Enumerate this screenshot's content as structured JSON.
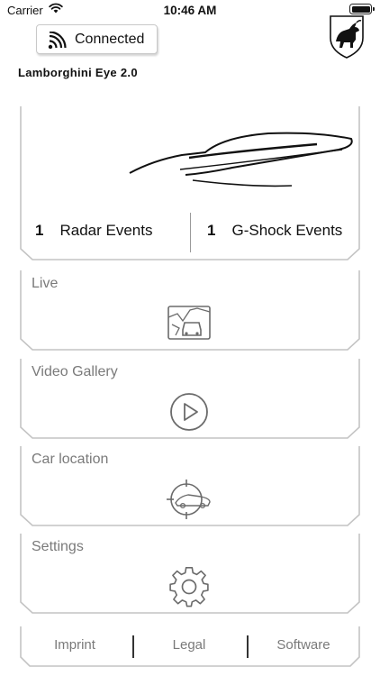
{
  "status_bar": {
    "carrier": "Carrier",
    "time": "10:46 AM"
  },
  "connection": {
    "label": "Connected",
    "icon": "wifi-signal-icon"
  },
  "app_title": "Lamborghini Eye 2.0",
  "logo": "bull-logo",
  "events": {
    "radar": {
      "count": "1",
      "label": "Radar Events"
    },
    "gshock": {
      "count": "1",
      "label": "G-Shock Events"
    }
  },
  "menu": {
    "live": {
      "label": "Live",
      "icon": "live-map-icon"
    },
    "gallery": {
      "label": "Video Gallery",
      "icon": "play-icon"
    },
    "location": {
      "label": "Car location",
      "icon": "car-location-icon"
    },
    "settings": {
      "label": "Settings",
      "icon": "gear-icon"
    }
  },
  "footer": {
    "imprint": "Imprint",
    "legal": "Legal",
    "software": "Software"
  },
  "colors": {
    "text_primary": "#111111",
    "text_muted": "#7a7a7a",
    "frame": "#c4c4c4"
  }
}
